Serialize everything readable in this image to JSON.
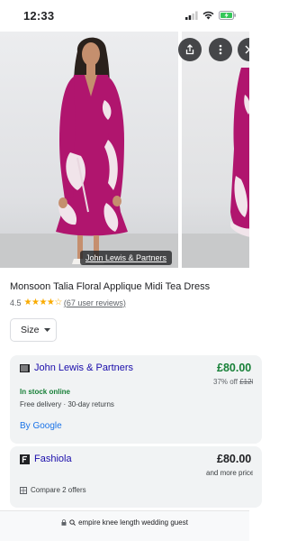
{
  "status_bar": {
    "time": "12:33"
  },
  "colors": {
    "link": "#1a0dab",
    "price_green": "#188038",
    "instock_green": "#188038",
    "dress_magenta": "#b0156e",
    "google_blue": "#1a73e8"
  },
  "carousel": {
    "source_label": "John Lewis & Partners"
  },
  "product": {
    "title": "Monsoon Talia Floral Applique Midi Tea Dress",
    "rating": "4.5",
    "stars": "★★★★☆",
    "reviews": "(67 user reviews)"
  },
  "filters": {
    "size_label": "Size"
  },
  "offers": [
    {
      "merchant": "John Lewis & Partners",
      "price": "£80.00",
      "discount": "37% off",
      "old_price": "£128",
      "stock": "In stock online",
      "delivery": "Free delivery · 30-day returns",
      "by": "By Google"
    },
    {
      "merchant": "Fashiola",
      "price": "£80.00",
      "more": "and more prices",
      "compare": "Compare 2 offers"
    }
  ],
  "bottom": {
    "query": "empire knee length  wedding guest"
  }
}
